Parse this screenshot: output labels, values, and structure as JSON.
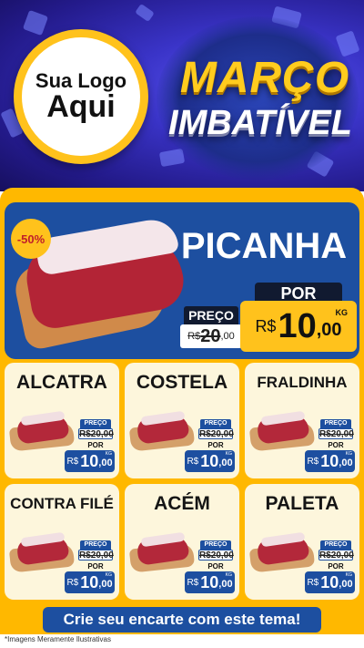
{
  "header": {
    "logo_line1": "Sua Logo",
    "logo_line2": "Aqui",
    "title_line1": "MARÇO",
    "title_line2": "IMBATÍVEL"
  },
  "featured": {
    "discount_badge": "-50%",
    "name": "PICANHA",
    "price_label": "PREÇO",
    "por_label": "POR",
    "old_currency": "R$",
    "old_int": "20",
    "old_dec": ",00",
    "new_currency": "R$",
    "new_int": "10",
    "new_dec": ",00",
    "unit": "KG"
  },
  "products": [
    {
      "name": "ALCATRA",
      "price_label": "PREÇO",
      "old": "R$20,00",
      "por": "POR",
      "currency": "R$",
      "int": "10",
      "dec": ",00",
      "unit": "KG"
    },
    {
      "name": "COSTELA",
      "price_label": "PREÇO",
      "old": "R$20,00",
      "por": "POR",
      "currency": "R$",
      "int": "10",
      "dec": ",00",
      "unit": "KG"
    },
    {
      "name": "FRALDINHA",
      "price_label": "PREÇO",
      "old": "R$20,00",
      "por": "POR",
      "currency": "R$",
      "int": "10",
      "dec": ",00",
      "unit": "KG"
    },
    {
      "name": "CONTRA FILÉ",
      "price_label": "PREÇO",
      "old": "R$20,00",
      "por": "POR",
      "currency": "R$",
      "int": "10",
      "dec": ",00",
      "unit": "KG"
    },
    {
      "name": "ACÉM",
      "price_label": "PREÇO",
      "old": "R$20,00",
      "por": "POR",
      "currency": "R$",
      "int": "10",
      "dec": ",00",
      "unit": "KG"
    },
    {
      "name": "PALETA",
      "price_label": "PREÇO",
      "old": "R$20,00",
      "por": "POR",
      "currency": "R$",
      "int": "10",
      "dec": ",00",
      "unit": "KG"
    }
  ],
  "cta": "Crie seu encarte com este tema!",
  "disclaimer": "*Imagens Meramente Ilustrativas",
  "colors": {
    "primary_blue": "#1d4fa0",
    "accent_yellow": "#ffc21c",
    "header_purple": "#3a34c8"
  }
}
